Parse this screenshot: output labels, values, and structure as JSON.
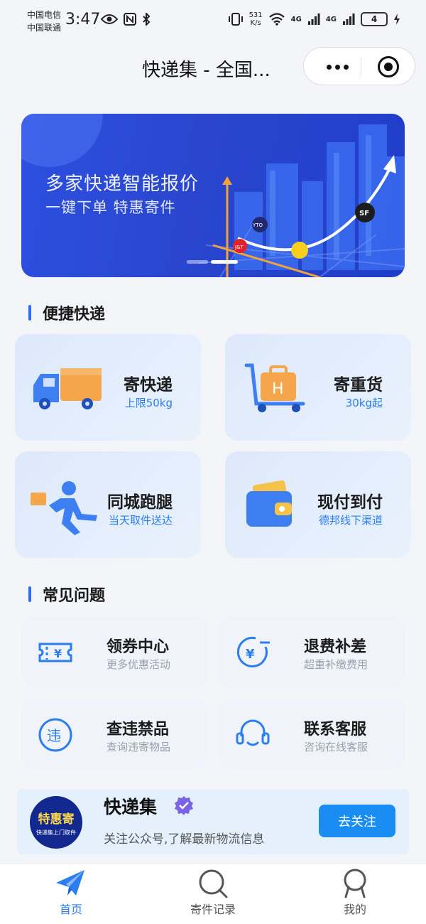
{
  "status": {
    "carrier1": "中国电信",
    "carrier2": "中国联通",
    "time": "3:47",
    "speed_value": "531",
    "speed_unit": "K/s",
    "net1": "4G",
    "net2": "4G",
    "battery": "4"
  },
  "header": {
    "title": "快递集 - 全国..."
  },
  "banner": {
    "title": "多家快递智能报价",
    "subtitle": "一键下单 特惠寄件",
    "logo_jt": "J&T",
    "logo_yto": "YTO",
    "logo_sf": "SF"
  },
  "section_express": "便捷快递",
  "services": [
    {
      "title": "寄快递",
      "subtitle": "上限50kg",
      "icon": "delivery-truck-icon"
    },
    {
      "title": "寄重货",
      "subtitle": "30kg起",
      "icon": "luggage-cart-icon"
    },
    {
      "title": "同城跑腿",
      "subtitle": "当天取件送达",
      "icon": "running-courier-icon"
    },
    {
      "title": "现付到付",
      "subtitle": "德邦线下渠道",
      "icon": "wallet-icon"
    }
  ],
  "section_faq": "常见问题",
  "faq": [
    {
      "title": "领券中心",
      "subtitle": "更多优惠活动",
      "icon": "coupon-icon",
      "glyph": "¥"
    },
    {
      "title": "退费补差",
      "subtitle": "超重补缴费用",
      "icon": "refund-icon",
      "glyph": "¥"
    },
    {
      "title": "查违禁品",
      "subtitle": "查询违寄物品",
      "icon": "prohibited-icon",
      "glyph": "违"
    },
    {
      "title": "联系客服",
      "subtitle": "咨询在线客服",
      "icon": "headset-icon"
    }
  ],
  "follow": {
    "logo_title": "特惠寄",
    "logo_sub": "快递集上门取件",
    "name": "快递集",
    "desc": "关注公众号,了解最新物流信息",
    "button": "去关注"
  },
  "tabs": [
    {
      "label": "首页",
      "icon": "paper-plane-icon",
      "active": true
    },
    {
      "label": "寄件记录",
      "icon": "search-icon",
      "active": false
    },
    {
      "label": "我的",
      "icon": "user-icon",
      "active": false
    }
  ],
  "colors": {
    "accent": "#2a7ef0",
    "button": "#1a8df5",
    "banner": "#2a46cf"
  }
}
